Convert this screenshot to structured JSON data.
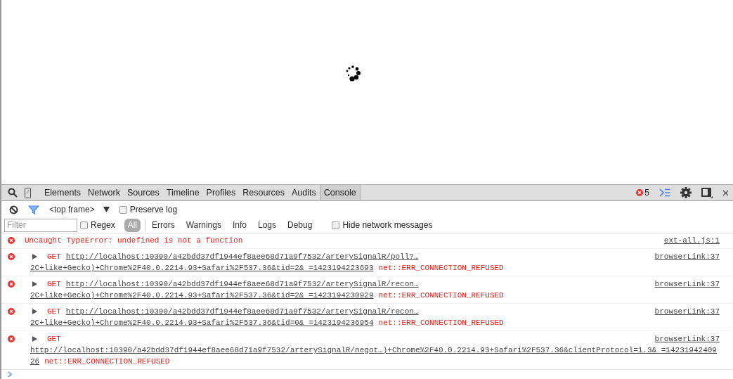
{
  "tabs": [
    {
      "label": "Elements",
      "selected": false
    },
    {
      "label": "Network",
      "selected": false
    },
    {
      "label": "Sources",
      "selected": false
    },
    {
      "label": "Timeline",
      "selected": false
    },
    {
      "label": "Profiles",
      "selected": false
    },
    {
      "label": "Resources",
      "selected": false
    },
    {
      "label": "Audits",
      "selected": false
    },
    {
      "label": "Console",
      "selected": true
    }
  ],
  "error_count": "5",
  "toolbar": {
    "frame": "<top frame>",
    "preserve_log": {
      "label": "Preserve log",
      "checked": false
    }
  },
  "filter": {
    "placeholder": "Filter",
    "regex": {
      "label": "Regex",
      "checked": false
    },
    "levels": [
      {
        "label": "All",
        "selected": true
      },
      {
        "label": "Errors",
        "selected": false
      },
      {
        "label": "Warnings",
        "selected": false
      },
      {
        "label": "Info",
        "selected": false
      },
      {
        "label": "Logs",
        "selected": false
      },
      {
        "label": "Debug",
        "selected": false
      }
    ],
    "hide_network": {
      "label": "Hide network messages",
      "checked": false
    }
  },
  "messages": [
    {
      "kind": "error",
      "text": "Uncaught TypeError: undefined is not a function",
      "source": "ext-all.js:1"
    },
    {
      "kind": "network",
      "source": "browserLink:37",
      "lines": [
        [
          {
            "kind": "method",
            "text": "GET"
          },
          {
            "kind": "url",
            "text": "http://localhost:10390/a42bdd37df1944ef8aee68d71a9f7532/arterySignalR/poll?…"
          }
        ],
        [
          {
            "kind": "url",
            "text": "2C+like+Gecko)+Chrome%2F40.0.2214.93+Safari%2F537.36&tid=2& =1423194223693"
          },
          {
            "kind": "status",
            "text": "net::ERR_CONNECTION_REFUSED"
          }
        ]
      ]
    },
    {
      "kind": "network",
      "source": "browserLink:37",
      "lines": [
        [
          {
            "kind": "method",
            "text": "GET"
          },
          {
            "kind": "url",
            "text": "http://localhost:10390/a42bdd37df1944ef8aee68d71a9f7532/arterySignalR/recon…"
          }
        ],
        [
          {
            "kind": "url",
            "text": "2C+like+Gecko)+Chrome%2F40.0.2214.93+Safari%2F537.36&tid=2& =1423194230929"
          },
          {
            "kind": "status",
            "text": "net::ERR_CONNECTION_REFUSED"
          }
        ]
      ]
    },
    {
      "kind": "network",
      "source": "browserLink:37",
      "lines": [
        [
          {
            "kind": "method",
            "text": "GET"
          },
          {
            "kind": "url",
            "text": "http://localhost:10390/a42bdd37df1944ef8aee68d71a9f7532/arterySignalR/recon…"
          }
        ],
        [
          {
            "kind": "url",
            "text": "2C+like+Gecko)+Chrome%2F40.0.2214.93+Safari%2F537.36&tid=0& =1423194236954"
          },
          {
            "kind": "status",
            "text": "net::ERR_CONNECTION_REFUSED"
          }
        ]
      ]
    },
    {
      "kind": "network",
      "source": "browserLink:37",
      "lines": [
        [
          {
            "kind": "method",
            "text": "GET"
          }
        ],
        [
          {
            "kind": "url",
            "text": "http://localhost:10390/a42bdd37df1944ef8aee68d71a9f7532/arterySignalR/negot…)+Chrome%2F40.0.2214.93+Safari%2F537.36&clientProtocol=1.3& =14231942409"
          }
        ],
        [
          {
            "kind": "url",
            "text": "26"
          },
          {
            "kind": "status",
            "text": "net::ERR_CONNECTION_REFUSED"
          }
        ]
      ]
    }
  ]
}
